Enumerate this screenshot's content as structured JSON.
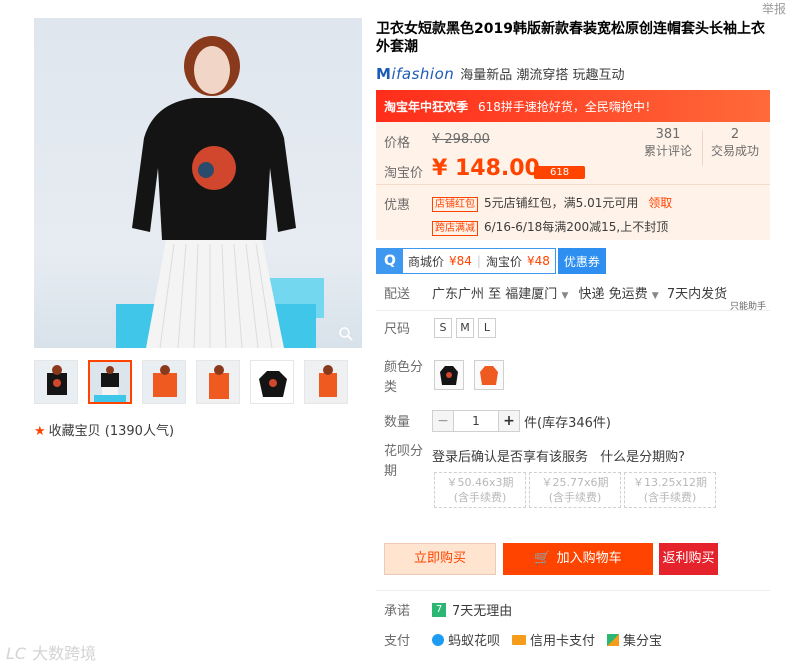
{
  "report_label": "举报",
  "favorite": {
    "label": "收藏宝贝 (1390人气)"
  },
  "product": {
    "title": "卫衣女短款黑色2019韩版新款春装宽松原创连帽套头长袖上衣外套潮",
    "brand": "ifashion",
    "brand_tagline": "海量新品 潮流穿搭 玩趣互动"
  },
  "promo_banner": {
    "title": "淘宝年中狂欢季",
    "text": "618拼手速抢好货，全民嗨抢中！"
  },
  "price": {
    "list_label": "价格",
    "list_value": "¥ 298.00",
    "tb_label": "淘宝价",
    "tb_value": "¥ 148.00",
    "badge": "618",
    "reviews_count": "381",
    "reviews_label": "累计评论",
    "sales_count": "2",
    "sales_label": "交易成功"
  },
  "discount": {
    "label": "优惠",
    "shop_tag": "店铺红包",
    "shop_text": "5元店铺红包，满5.01元可用",
    "shop_link": "领取",
    "cross_tag": "跨店满减",
    "cross_text": "6/16-6/18每满200减15,上不封顶"
  },
  "mall": {
    "mall_price_label": "商城价",
    "mall_price": "¥84",
    "tb_price_label": "淘宝价",
    "tb_price": "¥48",
    "coupon_label": "优惠券"
  },
  "shipping": {
    "label": "配送",
    "from": "广东广州 至",
    "to": "福建厦门",
    "express": "快递 免运费",
    "time": "7天内发货",
    "note": "只能助手"
  },
  "sizes": {
    "label": "尺码",
    "options": [
      "S",
      "M",
      "L"
    ]
  },
  "colors": {
    "label": "颜色分类"
  },
  "quantity": {
    "label": "数量",
    "value": "1",
    "stock": "件(库存346件)"
  },
  "huabei": {
    "label": "花呗分期",
    "text": "登录后确认是否享有该服务",
    "link": "什么是分期购?",
    "plans": [
      {
        "amount": "￥50.46x3期",
        "fee": "(含手续费)"
      },
      {
        "amount": "￥25.77x6期",
        "fee": "(含手续费)"
      },
      {
        "amount": "￥13.25x12期",
        "fee": "(含手续费)"
      }
    ]
  },
  "buttons": {
    "buy_now": "立即购买",
    "add_cart": "加入购物车",
    "rebate": "返利购买"
  },
  "promise": {
    "label": "承诺",
    "text": "7天无理由"
  },
  "payment": {
    "label": "支付",
    "methods": [
      "蚂蚁花呗",
      "信用卡支付",
      "集分宝"
    ]
  },
  "watermark": "大数跨境",
  "colors_theme": {
    "accent": "#ff4400",
    "price_bg": "#fff2e8",
    "blue": "#2f8ff0"
  }
}
